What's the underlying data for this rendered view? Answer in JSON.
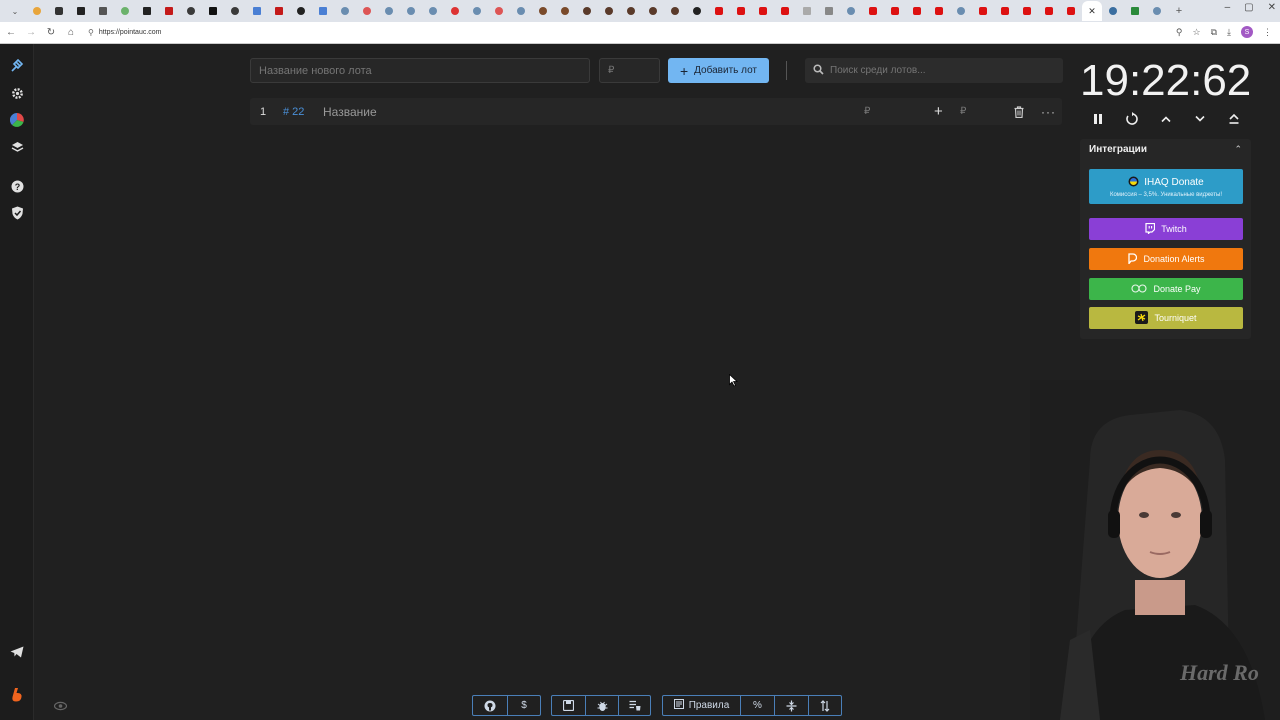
{
  "browser": {
    "url": "https://pointauc.com",
    "active_tab_icon": "close-icon"
  },
  "rail": {
    "items": [
      "auction-icon",
      "settings-icon",
      "wheel-icon",
      "layers-icon",
      "help-icon",
      "shield-icon"
    ],
    "bottom": [
      "telegram-icon",
      "boosty-icon"
    ]
  },
  "top": {
    "lot_placeholder": "Название нового лота",
    "price_placeholder": "₽",
    "add_label": "Добавить лот",
    "search_placeholder": "Поиск среди лотов..."
  },
  "lot": {
    "num": "1",
    "id": "# 22",
    "name": "Название",
    "rub1": "₽",
    "rub2": "₽"
  },
  "timer": {
    "value": "19:22:62"
  },
  "integrations": {
    "title": "Интеграции",
    "ihaq_label": "IHAQ Donate",
    "ihaq_sub": "Комиссия – 3,5%. Уникальные виджеты!",
    "twitch_label": "Twitch",
    "da_label": "Donation Alerts",
    "dp_label": "Donate Pay",
    "tq_label": "Tourniquet",
    "colors": {
      "ihaq": "#2d9cc8",
      "twitch": "#8a3fd6",
      "donation_alerts": "#f0780e",
      "donate_pay": "#3cb54a",
      "tourniquet": "#b9b840"
    }
  },
  "bottom_bar": {
    "rules_label": "Правила",
    "percent_label": "%",
    "dollar_label": "$"
  }
}
